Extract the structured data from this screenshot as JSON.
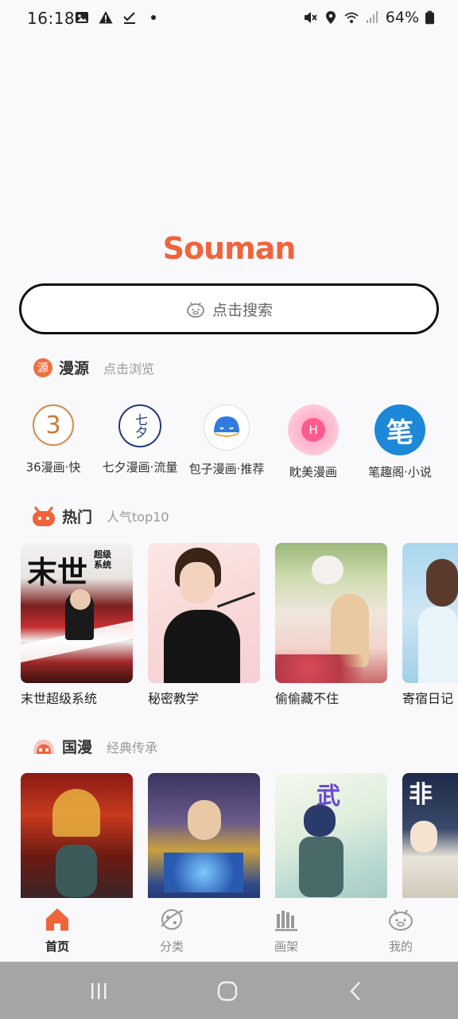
{
  "status": {
    "time": "16:18",
    "battery": "64%"
  },
  "brand": {
    "logo_text": "Souman",
    "accent": "#f0643c"
  },
  "search": {
    "placeholder": "点击搜索"
  },
  "sources_section": {
    "badge": "源",
    "title": "漫源",
    "subtitle": "点击浏览",
    "items": [
      {
        "label": "36漫画·快",
        "logo": "3"
      },
      {
        "label": "七夕漫画·流量",
        "logo": "七夕"
      },
      {
        "label": "包子漫画·推荐",
        "logo": "baozi"
      },
      {
        "label": "眈美漫画",
        "logo": "H"
      },
      {
        "label": "笔趣阁·小说",
        "logo": "笔"
      }
    ]
  },
  "hot_section": {
    "title": "热门",
    "subtitle": "人气top10",
    "items": [
      {
        "title": "末世超级系统",
        "cover_text": "末世",
        "cover_sub": "超级系统"
      },
      {
        "title": "秘密教学"
      },
      {
        "title": "偷偷藏不住"
      },
      {
        "title": "寄宿日记"
      }
    ]
  },
  "guoman_section": {
    "title": "国漫",
    "subtitle": "经典传承",
    "items": [
      {
        "title": ""
      },
      {
        "title": ""
      },
      {
        "title": "",
        "cover_text": "武"
      },
      {
        "title": "",
        "cover_text": "非"
      }
    ]
  },
  "bottom_nav": [
    {
      "label": "首页",
      "icon": "home-icon",
      "active": true
    },
    {
      "label": "分类",
      "icon": "category-icon",
      "active": false
    },
    {
      "label": "画架",
      "icon": "bookshelf-icon",
      "active": false
    },
    {
      "label": "我的",
      "icon": "profile-icon",
      "active": false
    }
  ]
}
